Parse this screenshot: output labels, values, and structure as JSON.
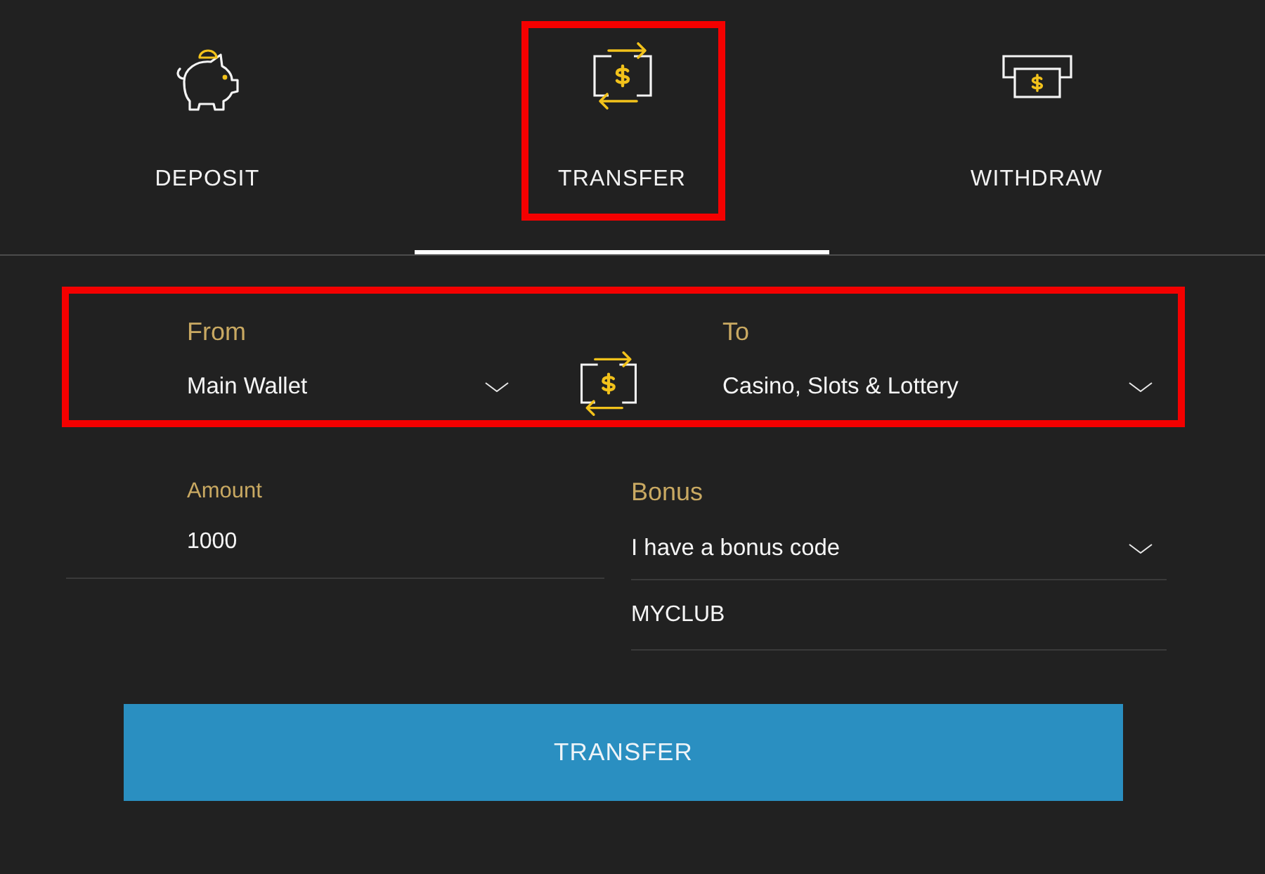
{
  "tabs": [
    {
      "kind": "deposit",
      "label": "DEPOSIT",
      "selected": false,
      "highlighted": false
    },
    {
      "kind": "transfer",
      "label": "TRANSFER",
      "selected": true,
      "highlighted": true
    },
    {
      "kind": "withdraw",
      "label": "WITHDRAW",
      "selected": false,
      "highlighted": false
    }
  ],
  "transfer_row": {
    "highlighted": true,
    "from": {
      "label": "From",
      "value": "Main Wallet"
    },
    "to": {
      "label": "To",
      "value": "Casino, Slots & Lottery"
    }
  },
  "amount": {
    "label": "Amount",
    "value": "1000"
  },
  "bonus": {
    "label": "Bonus",
    "value": "I have a bonus code",
    "code": "MYCLUB"
  },
  "submit_button": {
    "label": "TRANSFER"
  }
}
